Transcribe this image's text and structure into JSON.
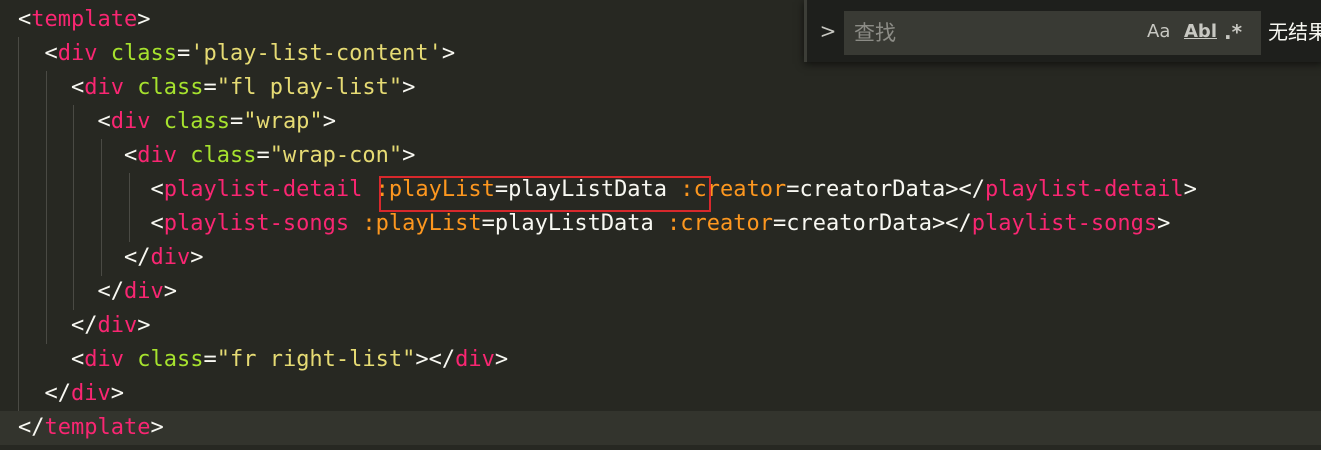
{
  "code": {
    "lines": [
      [
        [
          "p",
          "<"
        ],
        [
          "tag",
          "template"
        ],
        [
          "p",
          ">"
        ]
      ],
      [
        [
          "p",
          "  <"
        ],
        [
          "tag",
          "div"
        ],
        [
          "p",
          " "
        ],
        [
          "attr",
          "class"
        ],
        [
          "p",
          "="
        ],
        [
          "str",
          "'play-list-content'"
        ],
        [
          "p",
          ">"
        ]
      ],
      [
        [
          "p",
          "    <"
        ],
        [
          "tag",
          "div"
        ],
        [
          "p",
          " "
        ],
        [
          "attr",
          "class"
        ],
        [
          "p",
          "="
        ],
        [
          "str",
          "\"fl play-list\""
        ],
        [
          "p",
          ">"
        ]
      ],
      [
        [
          "p",
          "      <"
        ],
        [
          "tag",
          "div"
        ],
        [
          "p",
          " "
        ],
        [
          "attr",
          "class"
        ],
        [
          "p",
          "="
        ],
        [
          "str",
          "\"wrap\""
        ],
        [
          "p",
          ">"
        ]
      ],
      [
        [
          "p",
          "        <"
        ],
        [
          "tag",
          "div"
        ],
        [
          "p",
          " "
        ],
        [
          "attr",
          "class"
        ],
        [
          "p",
          "="
        ],
        [
          "str",
          "\"wrap-con\""
        ],
        [
          "p",
          ">"
        ]
      ],
      [
        [
          "p",
          "          <"
        ],
        [
          "tag",
          "playlist-detail"
        ],
        [
          "p",
          " "
        ],
        [
          "bind",
          ":playList"
        ],
        [
          "p",
          "=playListData "
        ],
        [
          "bind",
          ":creator"
        ],
        [
          "p",
          "=creatorData></"
        ],
        [
          "tag",
          "playlist-detail"
        ],
        [
          "p",
          ">"
        ]
      ],
      [
        [
          "p",
          "          <"
        ],
        [
          "tag",
          "playlist-songs"
        ],
        [
          "p",
          " "
        ],
        [
          "bind",
          ":playList"
        ],
        [
          "p",
          "=playListData "
        ],
        [
          "bind",
          ":creator"
        ],
        [
          "p",
          "=creatorData></"
        ],
        [
          "tag",
          "playlist-songs"
        ],
        [
          "p",
          ">"
        ]
      ],
      [
        [
          "p",
          "        </"
        ],
        [
          "tag",
          "div"
        ],
        [
          "p",
          ">"
        ]
      ],
      [
        [
          "p",
          "      </"
        ],
        [
          "tag",
          "div"
        ],
        [
          "p",
          ">"
        ]
      ],
      [
        [
          "p",
          "    </"
        ],
        [
          "tag",
          "div"
        ],
        [
          "p",
          ">"
        ]
      ],
      [
        [
          "p",
          "    <"
        ],
        [
          "tag",
          "div"
        ],
        [
          "p",
          " "
        ],
        [
          "attr",
          "class"
        ],
        [
          "p",
          "="
        ],
        [
          "str",
          "\"fr right-list\""
        ],
        [
          "p",
          "></"
        ],
        [
          "tag",
          "div"
        ],
        [
          "p",
          ">"
        ]
      ],
      [
        [
          "p",
          "  </"
        ],
        [
          "tag",
          "div"
        ],
        [
          "p",
          ">"
        ]
      ],
      [
        [
          "p",
          "</"
        ],
        [
          "tag",
          "template"
        ],
        [
          "p",
          ">"
        ]
      ]
    ]
  },
  "find_widget": {
    "toggle_glyph": ">",
    "placeholder": "查找",
    "value": "",
    "match_case_label": "Aa",
    "whole_word_label": "Abl",
    "regex_label": ".*",
    "result_text": "无结果"
  },
  "colors": {
    "background": "#272822",
    "tag": "#f92672",
    "attribute": "#a6e22e",
    "string": "#e6db74",
    "binding": "#fd971f",
    "highlight_box": "#d8282c"
  }
}
